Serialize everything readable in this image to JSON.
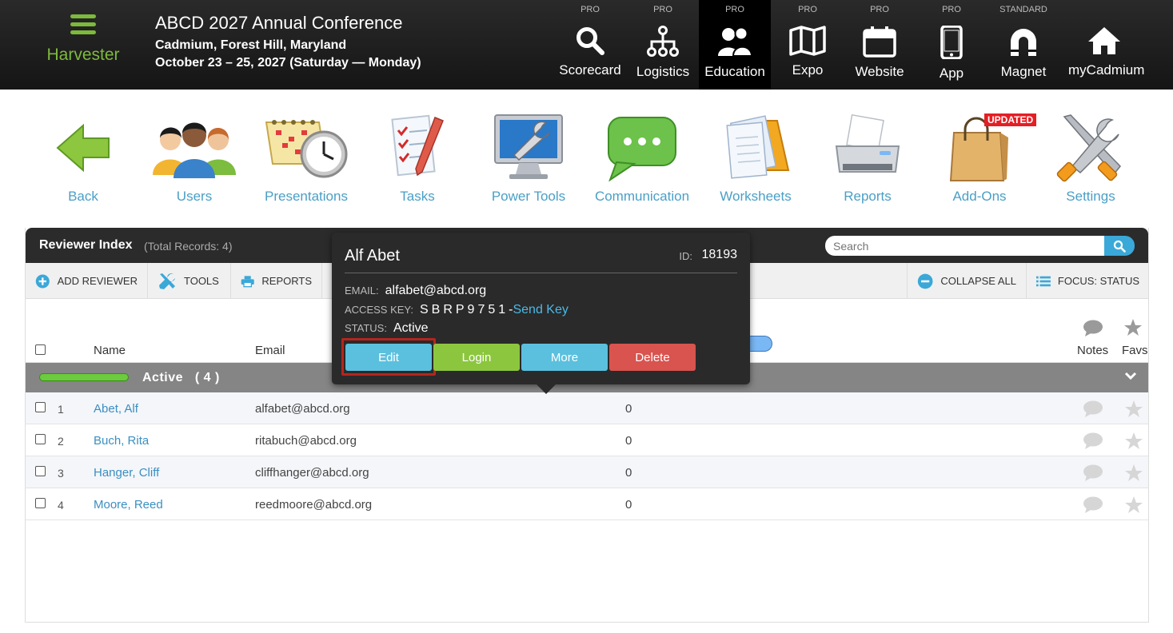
{
  "header": {
    "app_name": "Harvester",
    "conference_title": "ABCD 2027 Annual Conference",
    "location": "Cadmium, Forest Hill, Maryland",
    "dates": "October 23 – 25, 2027 (Saturday — Monday)",
    "nav": [
      {
        "tier": "PRO",
        "label": "Scorecard",
        "icon": "search-icon"
      },
      {
        "tier": "PRO",
        "label": "Logistics",
        "icon": "hierarchy-icon"
      },
      {
        "tier": "PRO",
        "label": "Education",
        "icon": "users-icon",
        "active": true
      },
      {
        "tier": "PRO",
        "label": "Expo",
        "icon": "map-icon"
      },
      {
        "tier": "PRO",
        "label": "Website",
        "icon": "calendar-icon"
      },
      {
        "tier": "PRO",
        "label": "App",
        "icon": "phone-icon"
      },
      {
        "tier": "STANDARD",
        "label": "Magnet",
        "icon": "magnet-icon"
      },
      {
        "tier": "",
        "label": "myCadmium",
        "icon": "home-icon"
      }
    ]
  },
  "modules": [
    {
      "label": "Back",
      "icon": "back-arrow-icon"
    },
    {
      "label": "Users",
      "icon": "users-group-icon"
    },
    {
      "label": "Presentations",
      "icon": "calendar-clock-icon"
    },
    {
      "label": "Tasks",
      "icon": "checklist-icon"
    },
    {
      "label": "Power Tools",
      "icon": "monitor-wrench-icon"
    },
    {
      "label": "Communication",
      "icon": "chat-bubble-icon"
    },
    {
      "label": "Worksheets",
      "icon": "documents-icon"
    },
    {
      "label": "Reports",
      "icon": "printer-icon"
    },
    {
      "label": "Add-Ons",
      "icon": "shopping-bag-icon",
      "badge": "UPDATED"
    },
    {
      "label": "Settings",
      "icon": "tools-icon"
    }
  ],
  "panel": {
    "title": "Reviewer Index",
    "total": "(Total Records: 4)",
    "search_placeholder": "Search",
    "toolbar": {
      "add": "ADD REVIEWER",
      "tools": "TOOLS",
      "reports": "REPORTS",
      "collapse": "COLLAPSE ALL",
      "focus": "FOCUS: STATUS"
    },
    "columns": {
      "name": "Name",
      "email": "Email",
      "notes": "Notes",
      "favs": "Favs"
    },
    "group": {
      "label": "Active",
      "count": "( 4 )"
    },
    "rows": [
      {
        "num": "1",
        "name": "Abet, Alf",
        "email": "alfabet@abcd.org",
        "value": "0"
      },
      {
        "num": "2",
        "name": "Buch, Rita",
        "email": "ritabuch@abcd.org",
        "value": "0"
      },
      {
        "num": "3",
        "name": "Hanger, Cliff",
        "email": "cliffhanger@abcd.org",
        "value": "0"
      },
      {
        "num": "4",
        "name": "Moore, Reed",
        "email": "reedmoore@abcd.org",
        "value": "0"
      }
    ]
  },
  "popup": {
    "name": "Alf Abet",
    "id_label": "ID:",
    "id": "18193",
    "email_label": "EMAIL:",
    "email": "alfabet@abcd.org",
    "access_label": "ACCESS KEY:",
    "access_key": "SBRP9751",
    "separator": "-",
    "send_key": "Send Key",
    "status_label": "STATUS:",
    "status": "Active",
    "buttons": {
      "edit": "Edit",
      "login": "Login",
      "more": "More",
      "delete": "Delete"
    }
  },
  "colors": {
    "green": "#7dba3c",
    "link_blue": "#4a9fc6",
    "edit_blue": "#5bc0de",
    "login_green": "#8cc63f",
    "delete_red": "#d9534f",
    "highlight": "#b3261e"
  }
}
